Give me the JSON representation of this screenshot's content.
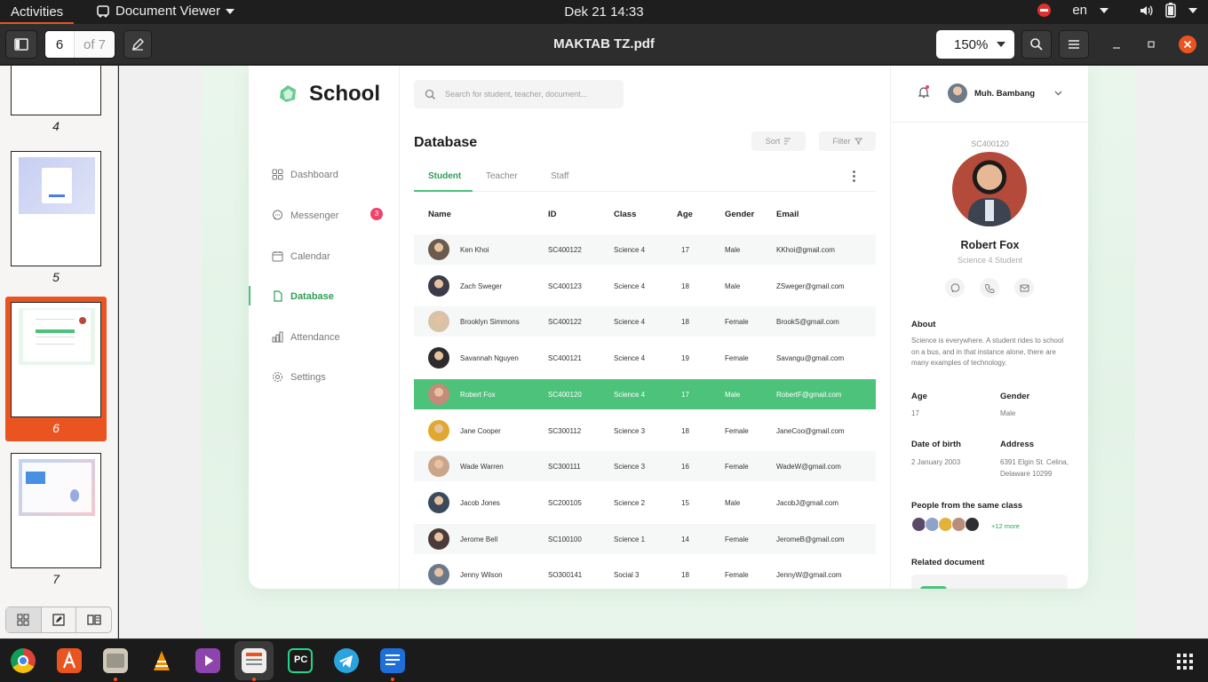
{
  "topbar": {
    "activities": "Activities",
    "app_name": "Document Viewer",
    "clock": "Dek 21  14:33",
    "language": "en"
  },
  "header": {
    "page_current": "6",
    "page_total": "of 7",
    "title": "MAKTAB TZ.pdf",
    "zoom": "150%"
  },
  "sidebar": {
    "thumbnails": [
      {
        "label": "4"
      },
      {
        "label": "5"
      },
      {
        "label": "6",
        "selected": true
      },
      {
        "label": "7"
      }
    ]
  },
  "document": {
    "app": {
      "brand": "School",
      "brand_color": "#4cc27a",
      "nav": [
        {
          "label": "Dashboard",
          "icon": "grid-icon"
        },
        {
          "label": "Messenger",
          "icon": "chat-icon",
          "badge": "3"
        },
        {
          "label": "Calendar",
          "icon": "calendar-icon"
        },
        {
          "label": "Database",
          "icon": "file-icon",
          "active": true
        },
        {
          "label": "Attendance",
          "icon": "chart-icon"
        },
        {
          "label": "Settings",
          "icon": "gear-icon"
        }
      ],
      "search_placeholder": "Search for student, teacher, document...",
      "page_title": "Database",
      "sort_label": "Sort",
      "filter_label": "Filter",
      "tabs": [
        "Student",
        "Teacher",
        "Staff"
      ],
      "columns": [
        "Name",
        "ID",
        "Class",
        "Age",
        "Gender",
        "Email"
      ],
      "rows": [
        {
          "name": "Ken Khoi",
          "id": "SC400122",
          "class": "Science 4",
          "age": "17",
          "gender": "Male",
          "email": "KKhoi@gmail.com"
        },
        {
          "name": "Zach Sweger",
          "id": "SC400123",
          "class": "Science 4",
          "age": "18",
          "gender": "Male",
          "email": "ZSweger@gmail.com"
        },
        {
          "name": "Brooklyn Simmons",
          "id": "SC400122",
          "class": "Science 4",
          "age": "18",
          "gender": "Female",
          "email": "BrookS@gmail.com"
        },
        {
          "name": "Savannah Nguyen",
          "id": "SC400121",
          "class": "Science 4",
          "age": "19",
          "gender": "Female",
          "email": "Savangu@gmail.com"
        },
        {
          "name": "Robert Fox",
          "id": "SC400120",
          "class": "Science 4",
          "age": "17",
          "gender": "Male",
          "email": "RobertF@gmail.com"
        },
        {
          "name": "Jane Cooper",
          "id": "SC300112",
          "class": "Science 3",
          "age": "18",
          "gender": "Female",
          "email": "JaneCoo@gmail.com"
        },
        {
          "name": "Wade Warren",
          "id": "SC300111",
          "class": "Science 3",
          "age": "16",
          "gender": "Female",
          "email": "WadeW@gmail.com"
        },
        {
          "name": "Jacob Jones",
          "id": "SC200105",
          "class": "Science 2",
          "age": "15",
          "gender": "Male",
          "email": "JacobJ@gmail.com"
        },
        {
          "name": "Jerome Bell",
          "id": "SC100100",
          "class": "Science 1",
          "age": "14",
          "gender": "Female",
          "email": "JeromeB@gmail.com"
        },
        {
          "name": "Jenny Wilson",
          "id": "SO300141",
          "class": "Social 3",
          "age": "18",
          "gender": "Female",
          "email": "JennyW@gmail.com"
        }
      ],
      "user_name": "Muh. Bambang",
      "profile": {
        "id": "SC400120",
        "name": "Robert Fox",
        "subtitle": "Science 4 Student",
        "about_title": "About",
        "about_text": "Science is everywhere. A student rides to school on a bus, and in that instance alone, there are many examples of technology.",
        "age_label": "Age",
        "age": "17",
        "gender_label": "Gender",
        "gender": "Male",
        "dob_label": "Date of birth",
        "dob": "2 January 2003",
        "address_label": "Address",
        "address": "6391 Elgin St. Celina, Delaware 10299",
        "classmates_title": "People from the same class",
        "classmates_more": "+12 more",
        "related_title": "Related document"
      }
    }
  }
}
